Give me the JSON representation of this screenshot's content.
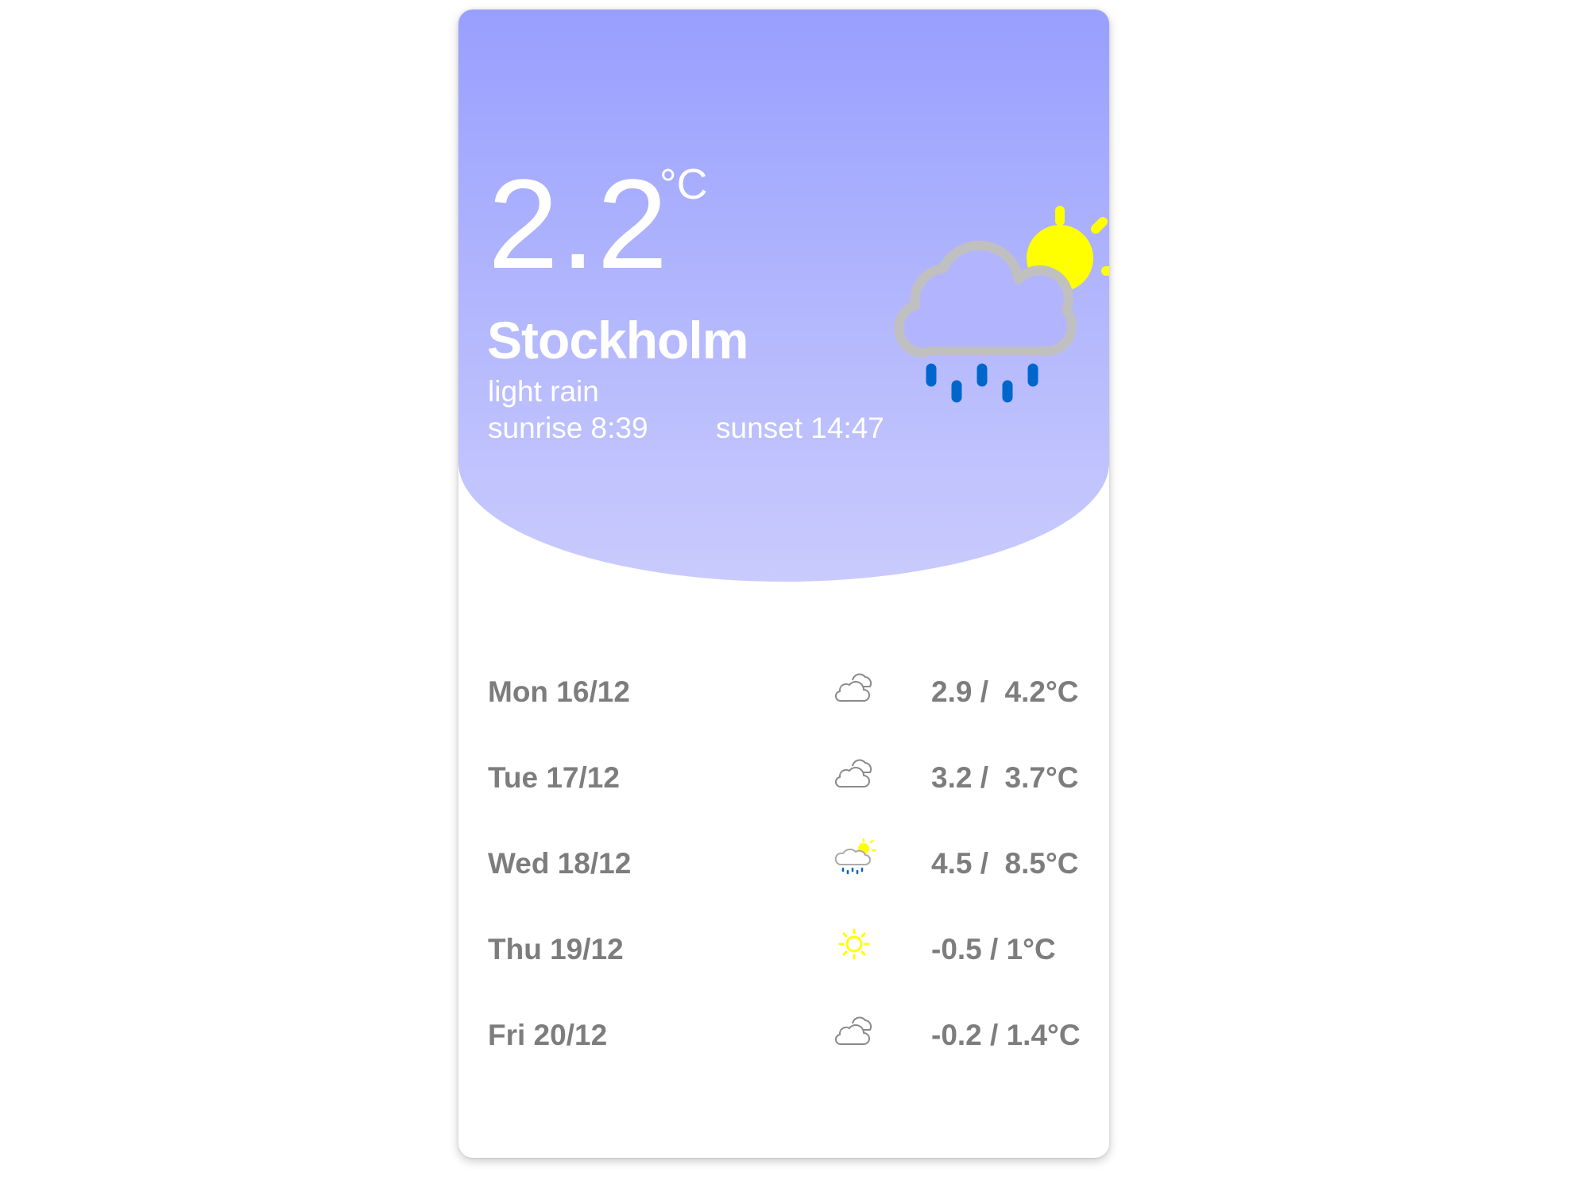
{
  "current": {
    "temperature": "2.2",
    "unit": "°C",
    "city": "Stockholm",
    "description": "light rain",
    "sunrise": "sunrise 8:39",
    "sunset": "sunset 14:47",
    "icon": "cloud-sun-rain-icon"
  },
  "forecast": [
    {
      "day": "Mon 16/12",
      "icon": "cloudy-icon",
      "range": "2.9 /  4.2°C"
    },
    {
      "day": "Tue 17/12",
      "icon": "cloudy-icon",
      "range": "3.2 /  3.7°C"
    },
    {
      "day": "Wed 18/12",
      "icon": "cloud-sun-rain-icon",
      "range": "4.5 /  8.5°C"
    },
    {
      "day": "Thu 19/12",
      "icon": "sun-icon",
      "range": "-0.5 / 1°C"
    },
    {
      "day": "Fri 20/12",
      "icon": "cloudy-icon",
      "range": "-0.2 / 1.4°C"
    }
  ],
  "colors": {
    "gradient_top": "#989ffe",
    "gradient_bottom": "#c9cbfd",
    "sun": "#ffff00",
    "rain": "#0066cc",
    "cloud": "#c0c0c0",
    "text_muted": "#7d7d7d"
  }
}
